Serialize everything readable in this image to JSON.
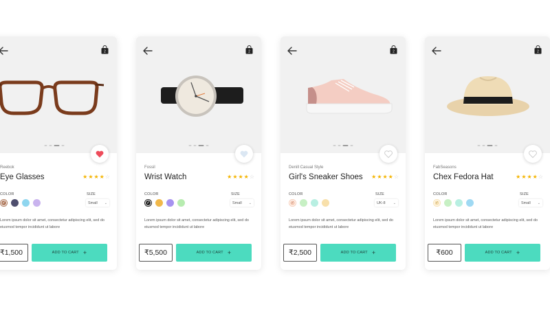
{
  "cart_badge": "2",
  "products": [
    {
      "brand": "Reebok",
      "name": "Eye Glasses",
      "rating": 4,
      "color_label": "COLOR",
      "size_label": "SIZE",
      "size_value": "Small",
      "swatches": [
        "#b07a5d",
        "#4e4e6e",
        "#8fd6ef",
        "#c9b3ee"
      ],
      "selected_swatch": 0,
      "description": "Lorem ipsum dolor sit amet, consectetur adipiscing elit, sed do eiusmod tempor incididunt ut labore",
      "price": "₹1,500",
      "cta": "ADD TO CART",
      "favorited": true,
      "product": "eyeglasses"
    },
    {
      "brand": "Fossil",
      "name": "Wrist Watch",
      "rating": 4,
      "color_label": "COLOR",
      "size_label": "SIZE",
      "size_value": "Small",
      "swatches": [
        "#1f1f1f",
        "#f1b84a",
        "#a692f0",
        "#b7ecb0"
      ],
      "selected_swatch": 0,
      "description": "Lorem ipsum dolor sit amet, consectetur adipiscing elit, sed do eiusmod tempor incididunt ut labore",
      "price": "₹5,500",
      "cta": "ADD TO CART",
      "favorited": false,
      "product": "watch"
    },
    {
      "brand": "Denill Casual Style",
      "name": "Girl's Sneaker Shoes",
      "rating": 4,
      "color_label": "COLOR",
      "size_label": "SIZE",
      "size_value": "UK-8",
      "swatches": [
        "#f6cdb8",
        "#c7f0c4",
        "#b8efe2",
        "#f8e0ab"
      ],
      "selected_swatch": 0,
      "description": "Lorem ipsum dolor sit amet, consectetur adipiscing elit, sed do eiusmod tempor incididunt ut labore",
      "price": "₹2,500",
      "cta": "ADD TO CART",
      "favorited": false,
      "product": "sneaker"
    },
    {
      "brand": "FabSeasons",
      "name": "Chex Fedora Hat",
      "rating": 4,
      "color_label": "COLOR",
      "size_label": "SIZE",
      "size_value": "Small",
      "swatches": [
        "#f8e2b3",
        "#c7f0c4",
        "#b8efe2",
        "#9fd9f3"
      ],
      "selected_swatch": 0,
      "description": "Lorem ipsum dolor sit amet, consectetur adipiscing elit, sed do eiusmod tempor incididunt ut labore",
      "price": "₹600",
      "cta": "ADD TO CART",
      "favorited": false,
      "product": "hat"
    }
  ],
  "colors": {
    "accent": "#4cdbbf",
    "favorite": "#ee4c5b",
    "star": "#f4b400"
  },
  "icons": {
    "back": "arrow-left-icon",
    "bag": "shopping-bag-icon",
    "favorite": "heart-icon",
    "add": "plus-icon",
    "size": "chevron-down-icon"
  }
}
